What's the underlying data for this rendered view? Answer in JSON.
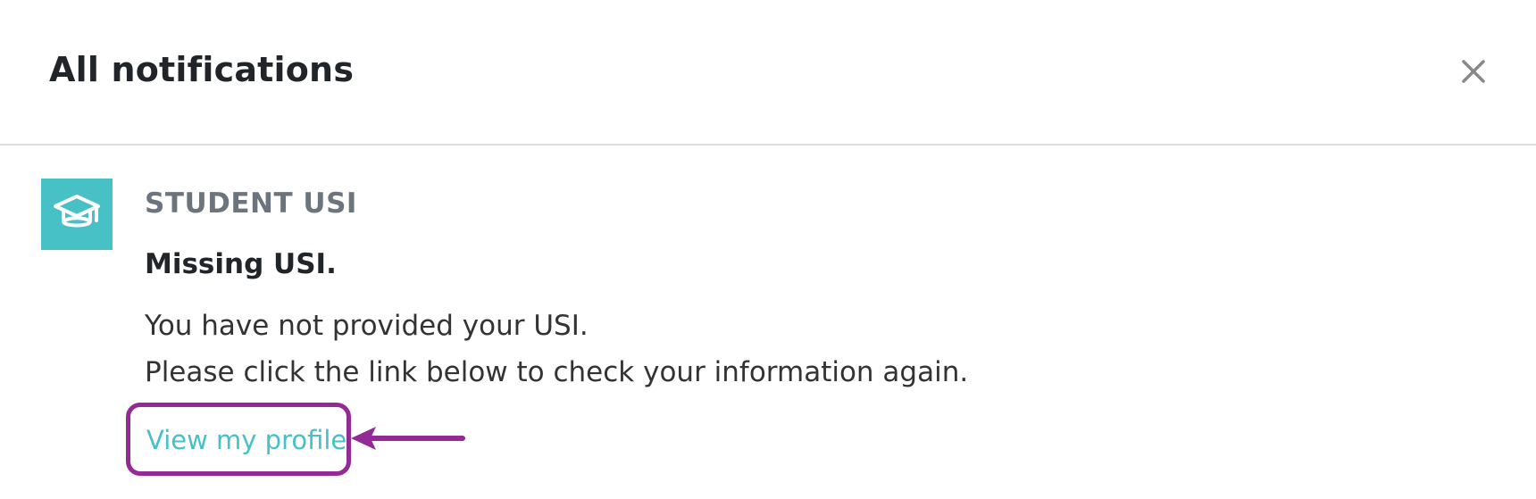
{
  "dialog": {
    "title": "All notifications",
    "close_icon": "close-icon"
  },
  "notification": {
    "icon": "graduation-cap-icon",
    "icon_bg_color": "#47c1c6",
    "category": "STUDENT USI",
    "subject": "Missing USI.",
    "message_lines": [
      "You have not provided your USI.",
      "Please click the link below to check your information again."
    ],
    "link_label": "View my profile",
    "link_color": "#47c1c6"
  },
  "annotation": {
    "highlight_color": "#942a96",
    "arrow_icon": "arrow-left-icon"
  }
}
